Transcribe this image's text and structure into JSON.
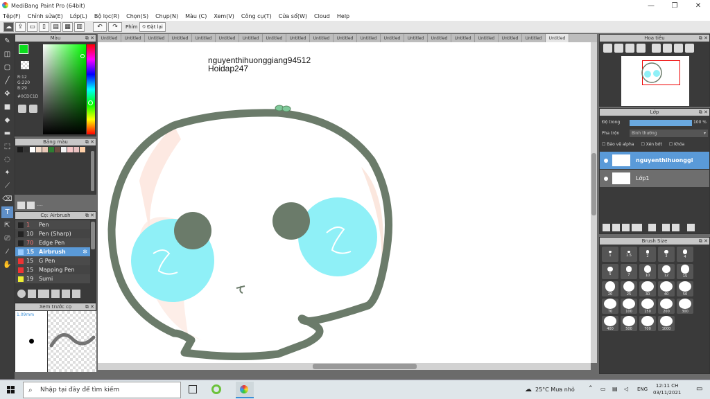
{
  "window": {
    "title": "MediBang Paint Pro (64bit)",
    "minimize": "—",
    "maximize": "❐",
    "close": "✕"
  },
  "menu": [
    "Tệp(F)",
    "Chỉnh sửa(E)",
    "Lớp(L)",
    "Bộ lọc(R)",
    "Chọn(S)",
    "Chụp(N)",
    "Màu (C)",
    "Xem(V)",
    "Công cụ(T)",
    "Cửa sổ(W)",
    "Cloud",
    "Help"
  ],
  "toolbar": {
    "key_label": "Phím",
    "reset_label": "Đặt lại"
  },
  "tabs": [
    "Untitled",
    "Untitled",
    "Untitled",
    "Untitled",
    "Untitled",
    "Untitled",
    "Untitled",
    "Untitled",
    "Untitled",
    "Untitled",
    "Untitled",
    "Untitled",
    "Untitled",
    "Untitled",
    "Untitled",
    "Untitled",
    "Untitled",
    "Untitled",
    "Untitled",
    "Untitled"
  ],
  "color_panel": {
    "title": "Màu",
    "r": "R:12",
    "g": "G:220",
    "b": "B:29",
    "hex": "#0CDC1D",
    "fg_color": "#0cdc1d"
  },
  "swatch_panel": {
    "title": "Bảng màu",
    "swatches": [
      "#1a1a1a",
      "#333",
      "#fff",
      "#f2dccb",
      "#e8c7b6",
      "#2e7d32",
      "#6d4c41",
      "#f3f3f3",
      "#f8c8c8",
      "#e8c1c1",
      "#ffd0a8"
    ],
    "counter": "----"
  },
  "brush_panel": {
    "title": "Cọ: Airbrush",
    "items": [
      {
        "size": "1",
        "name": "Pen",
        "color": "#222",
        "selected": false
      },
      {
        "size": "10",
        "name": "Pen (Sharp)",
        "color": "#222",
        "selected": false
      },
      {
        "size": "70",
        "name": "Edge Pen",
        "color": "#222",
        "selected": false
      },
      {
        "size": "15",
        "name": "Airbrush",
        "color": "#9cf",
        "selected": true
      },
      {
        "size": "15",
        "name": "G Pen",
        "color": "#e33",
        "selected": false
      },
      {
        "size": "15",
        "name": "Mapping Pen",
        "color": "#e33",
        "selected": false
      },
      {
        "size": "19",
        "name": "Sumi",
        "color": "#ee3",
        "selected": false
      }
    ]
  },
  "preview_panel": {
    "title": "Xem trước cọ",
    "size_label": "1.09mm"
  },
  "canvas": {
    "text_line1": "nguyenthihuonggiang94512",
    "text_line2": "Hoidap247"
  },
  "navigator": {
    "title": "Hoa tiêu"
  },
  "layer_panel": {
    "title": "Lớp",
    "opacity_label": "Độ trong",
    "opacity_value": "100 %",
    "blend_label": "Pha trộn",
    "blend_value": "Bình thường",
    "alpha_lock": "Bảo vệ alpha",
    "clip": "Xén bớt",
    "lock": "Khóa",
    "opacity_fraction": 1.0,
    "layers": [
      {
        "name": "nguyenthihuonggi",
        "selected": true
      },
      {
        "name": "Lớp1",
        "selected": false
      }
    ]
  },
  "brush_size": {
    "title": "Brush Size",
    "sizes": [
      "1",
      "1.5",
      "2",
      "3",
      "4",
      "5",
      "7",
      "10",
      "12",
      "15",
      "20",
      "25",
      "30",
      "40",
      "50",
      "70",
      "100",
      "150",
      "200",
      "300",
      "400",
      "500",
      "700",
      "1000"
    ]
  },
  "taskbar": {
    "search_placeholder": "Nhập tại đây để tìm kiếm",
    "weather": "25°C  Mưa nhỏ",
    "lang": "ENG",
    "time": "12:11 CH",
    "date": "03/11/2021"
  }
}
